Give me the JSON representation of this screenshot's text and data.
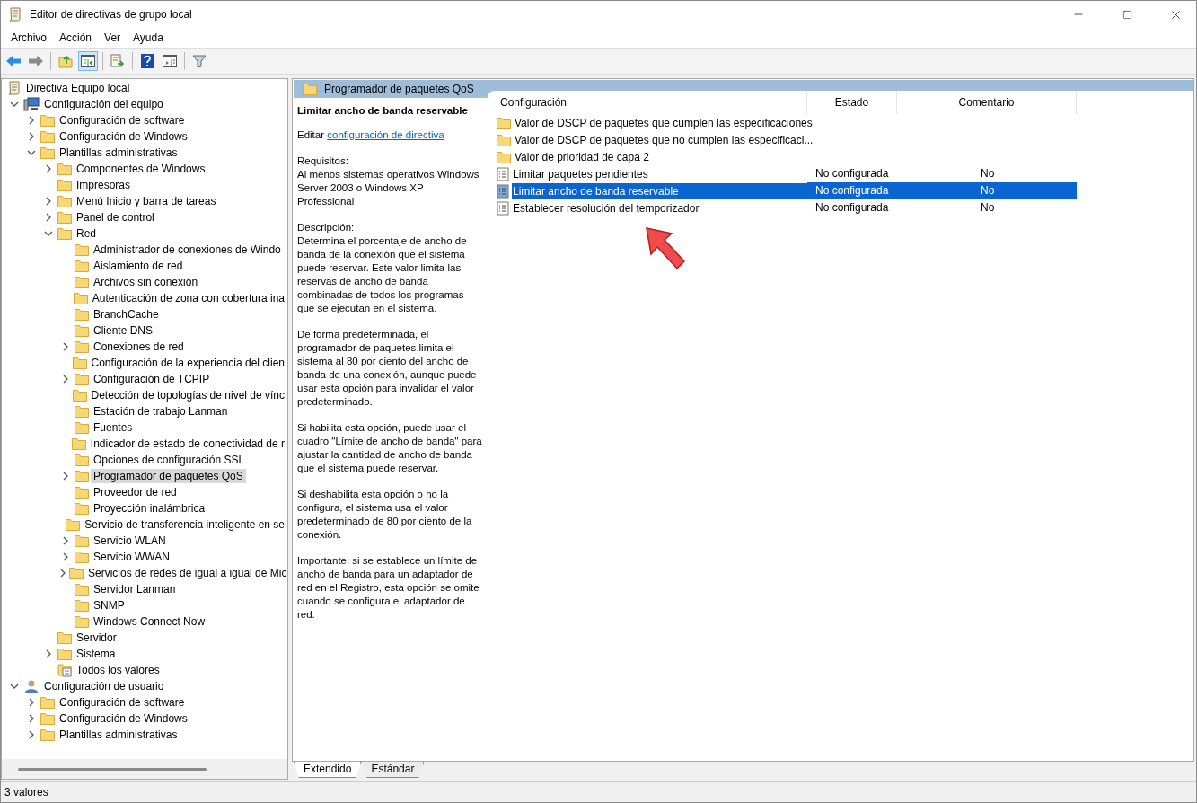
{
  "window": {
    "title": "Editor de directivas de grupo local"
  },
  "menu": [
    "Archivo",
    "Acción",
    "Ver",
    "Ayuda"
  ],
  "toolbar": [
    {
      "kind": "back",
      "pressed": false
    },
    {
      "kind": "forward",
      "pressed": false
    },
    {
      "kind": "sep"
    },
    {
      "kind": "up",
      "pressed": false
    },
    {
      "kind": "tree",
      "pressed": true
    },
    {
      "kind": "sep"
    },
    {
      "kind": "export",
      "pressed": false
    },
    {
      "kind": "sep"
    },
    {
      "kind": "help",
      "pressed": false
    },
    {
      "kind": "pane",
      "pressed": false
    },
    {
      "kind": "sep"
    },
    {
      "kind": "filter",
      "pressed": false
    }
  ],
  "tree": [
    {
      "label": "Directiva Equipo local",
      "kind": "policy",
      "selected": false,
      "children": [
        {
          "label": "Configuración del equipo",
          "kind": "computer",
          "expanded": true,
          "selected": false,
          "children": [
            {
              "label": "Configuración de software",
              "kind": "folder",
              "expanded": false,
              "selected": false
            },
            {
              "label": "Configuración de Windows",
              "kind": "folder",
              "expanded": false,
              "selected": false
            },
            {
              "label": "Plantillas administrativas",
              "kind": "folder",
              "expanded": true,
              "selected": false,
              "children": [
                {
                  "label": "Componentes de Windows",
                  "kind": "folder",
                  "expanded": false,
                  "selected": false
                },
                {
                  "label": "Impresoras",
                  "kind": "folder",
                  "selected": false
                },
                {
                  "label": "Menú Inicio y barra de tareas",
                  "kind": "folder",
                  "expanded": false,
                  "selected": false
                },
                {
                  "label": "Panel de control",
                  "kind": "folder",
                  "expanded": false,
                  "selected": false
                },
                {
                  "label": "Red",
                  "kind": "folder",
                  "expanded": true,
                  "selected": false,
                  "children": [
                    {
                      "label": "Administrador de conexiones de Windo",
                      "kind": "folder",
                      "selected": false
                    },
                    {
                      "label": "Aislamiento de red",
                      "kind": "folder",
                      "selected": false
                    },
                    {
                      "label": "Archivos sin conexión",
                      "kind": "folder",
                      "selected": false
                    },
                    {
                      "label": "Autenticación de zona con cobertura ina",
                      "kind": "folder",
                      "selected": false
                    },
                    {
                      "label": "BranchCache",
                      "kind": "folder",
                      "selected": false
                    },
                    {
                      "label": "Cliente DNS",
                      "kind": "folder",
                      "selected": false
                    },
                    {
                      "label": "Conexiones de red",
                      "kind": "folder",
                      "expanded": false,
                      "selected": false
                    },
                    {
                      "label": "Configuración de la experiencia del clien",
                      "kind": "folder",
                      "selected": false
                    },
                    {
                      "label": "Configuración de TCPIP",
                      "kind": "folder",
                      "expanded": false,
                      "selected": false
                    },
                    {
                      "label": "Detección de topologías de nivel de vínc",
                      "kind": "folder",
                      "selected": false
                    },
                    {
                      "label": "Estación de trabajo Lanman",
                      "kind": "folder",
                      "selected": false
                    },
                    {
                      "label": "Fuentes",
                      "kind": "folder",
                      "selected": false
                    },
                    {
                      "label": "Indicador de estado de conectividad de r",
                      "kind": "folder",
                      "selected": false
                    },
                    {
                      "label": "Opciones de configuración SSL",
                      "kind": "folder",
                      "selected": false
                    },
                    {
                      "label": "Programador de paquetes QoS",
                      "kind": "folder",
                      "expanded": false,
                      "selected": true
                    },
                    {
                      "label": "Proveedor de red",
                      "kind": "folder",
                      "selected": false
                    },
                    {
                      "label": "Proyección inalámbrica",
                      "kind": "folder",
                      "selected": false
                    },
                    {
                      "label": "Servicio de transferencia inteligente en se",
                      "kind": "folder",
                      "selected": false
                    },
                    {
                      "label": "Servicio WLAN",
                      "kind": "folder",
                      "expanded": false,
                      "selected": false
                    },
                    {
                      "label": "Servicio WWAN",
                      "kind": "folder",
                      "expanded": false,
                      "selected": false
                    },
                    {
                      "label": "Servicios de redes de igual a igual de Mic",
                      "kind": "folder",
                      "expanded": false,
                      "selected": false
                    },
                    {
                      "label": "Servidor Lanman",
                      "kind": "folder",
                      "selected": false
                    },
                    {
                      "label": "SNMP",
                      "kind": "folder",
                      "selected": false
                    },
                    {
                      "label": "Windows Connect Now",
                      "kind": "folder",
                      "selected": false
                    }
                  ]
                },
                {
                  "label": "Servidor",
                  "kind": "folder",
                  "selected": false
                },
                {
                  "label": "Sistema",
                  "kind": "folder",
                  "expanded": false,
                  "selected": false
                },
                {
                  "label": "Todos los valores",
                  "kind": "allvalues",
                  "selected": false
                }
              ]
            }
          ]
        },
        {
          "label": "Configuración de usuario",
          "kind": "user",
          "expanded": true,
          "selected": false,
          "children": [
            {
              "label": "Configuración de software",
              "kind": "folder",
              "expanded": false,
              "selected": false
            },
            {
              "label": "Configuración de Windows",
              "kind": "folder",
              "expanded": false,
              "selected": false
            },
            {
              "label": "Plantillas administrativas",
              "kind": "folder",
              "expanded": false,
              "selected": false
            }
          ]
        }
      ]
    }
  ],
  "pane_header": {
    "title": "Programador de paquetes QoS"
  },
  "description": {
    "title": "Limitar ancho de banda reservable",
    "edit_prefix": "Editar",
    "edit_link": "configuración de directiva",
    "paragraphs": [
      "Requisitos:\nAl menos sistemas operativos Windows Server 2003 o Windows XP Professional",
      "Descripción:\nDetermina el porcentaje de ancho de banda de la conexión que el sistema puede reservar. Este valor limita las reservas de ancho de banda combinadas de todos los programas que se ejecutan en el sistema.",
      "De forma predeterminada, el programador de paquetes limita el sistema al 80 por ciento del ancho de banda de una conexión, aunque puede usar esta opción para invalidar el valor predeterminado.",
      "Si habilita esta opción, puede usar el cuadro \"Límite de ancho de banda\" para ajustar la cantidad de ancho de banda que el sistema puede reservar.",
      "Si deshabilita esta opción o no la configura, el sistema usa el valor predeterminado de 80 por ciento de la conexión.",
      "Importante: si se establece un límite de ancho de banda para un adaptador de red en el Registro, esta opción se omite cuando se configura el adaptador de red."
    ]
  },
  "list": {
    "columns": [
      "Configuración",
      "Estado",
      "Comentario"
    ],
    "rows": [
      {
        "kind": "folder",
        "name": "Valor de DSCP de paquetes que cumplen las especificaciones",
        "selected": false
      },
      {
        "kind": "folder",
        "name": "Valor de DSCP de paquetes que no cumplen las especificaci...",
        "selected": false
      },
      {
        "kind": "folder",
        "name": "Valor de prioridad de capa 2",
        "selected": false
      },
      {
        "kind": "setting",
        "name": "Limitar paquetes pendientes",
        "state": "No configurada",
        "comment": "No",
        "selected": false
      },
      {
        "kind": "setting",
        "name": "Limitar ancho de banda reservable",
        "state": "No configurada",
        "comment": "No",
        "selected": true
      },
      {
        "kind": "setting",
        "name": "Establecer resolución del temporizador",
        "state": "No configurada",
        "comment": "No",
        "selected": false
      }
    ]
  },
  "view_tabs": [
    {
      "label": "Extendido",
      "selected": true
    },
    {
      "label": "Estándar",
      "selected": false
    }
  ],
  "status_bar": {
    "text": "3 valores"
  }
}
